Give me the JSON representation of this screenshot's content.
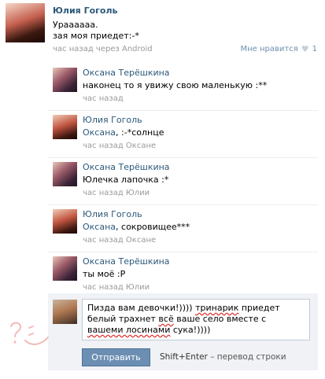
{
  "post": {
    "author": "Юлия Гоголь",
    "text": "Ураааааа.\nзая моя приедет:-*",
    "meta": "час назад через Android",
    "like_label": "Мне нравится",
    "like_count": "1"
  },
  "comments": [
    {
      "author": "Оксана Терёшкина",
      "mention": "",
      "text": "наконец то я увижу свою маленькую :**",
      "meta": "час назад",
      "avatar": "oksana"
    },
    {
      "author": "Юлия Гоголь",
      "mention": "Оксана",
      "text": ", :-*солнце",
      "meta": "час назад Оксане",
      "avatar": "yulia"
    },
    {
      "author": "Оксана Терёшкина",
      "mention": "",
      "text": "Юлечка лапочка :*",
      "meta": "час назад Юлии",
      "avatar": "oksana"
    },
    {
      "author": "Юлия Гоголь",
      "mention": "Оксана",
      "text": ", сокровищее***",
      "meta": "час назад Оксане",
      "avatar": "yulia"
    },
    {
      "author": "Оксана Терёшкина",
      "mention": "",
      "text": "ты моё :P",
      "meta": "час назад Юлии",
      "avatar": "oksana"
    }
  ],
  "reply": {
    "text_1": "Пизда вам девочки!)))) ",
    "text_2": "тринарик",
    "text_3": " приедет белый трахнет ",
    "text_4": "всё",
    "text_5": " ваше село вместе с ",
    "text_6": "вашеми лосинами",
    "text_7": " сука!))))",
    "send_label": "Отправить",
    "hint_keys": "Shift+Enter",
    "hint_text": " – перевод строки"
  },
  "colors": {
    "link": "#2b587a",
    "button": "#6c8eb2",
    "meta": "#999999"
  },
  "icons": {
    "like": "heart-icon"
  }
}
